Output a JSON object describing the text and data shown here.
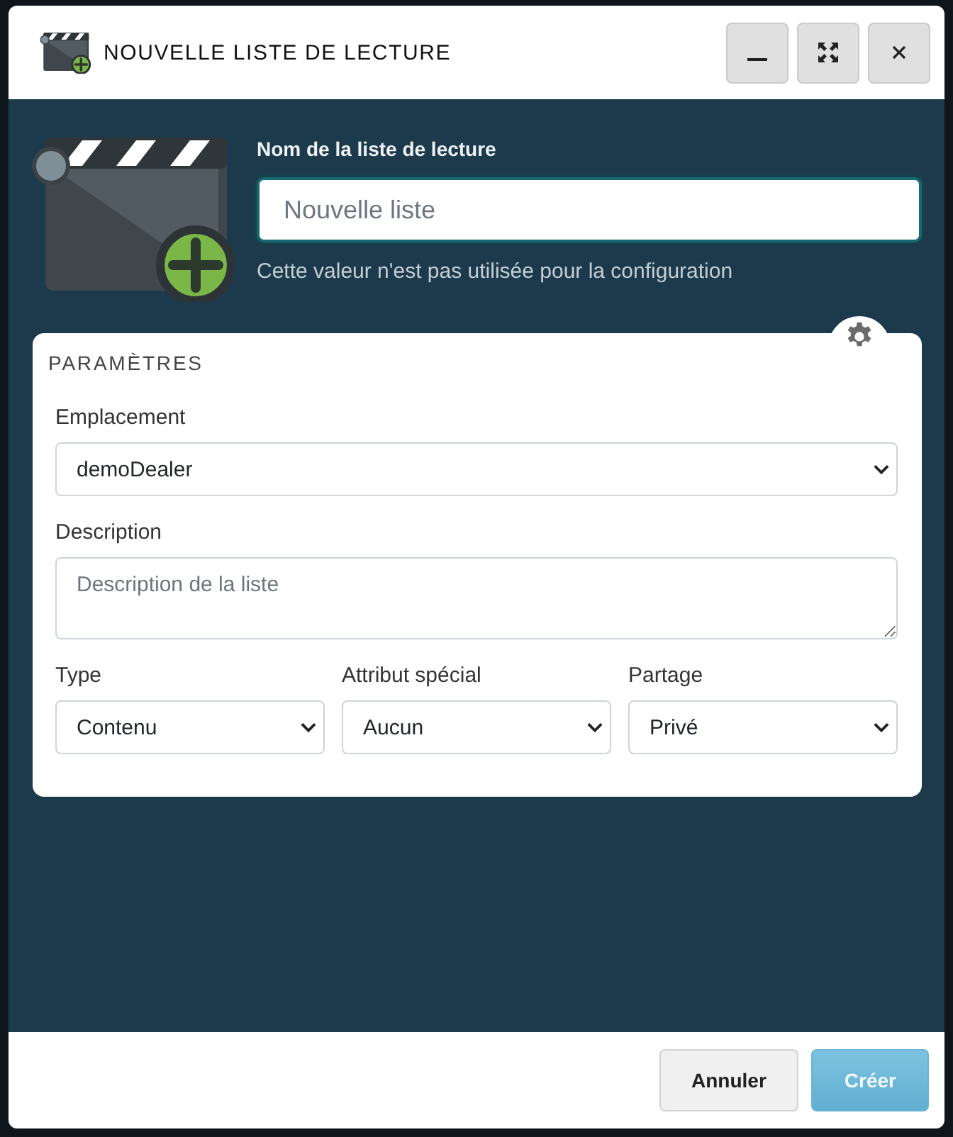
{
  "window": {
    "title": "NOUVELLE LISTE DE LECTURE"
  },
  "name_field": {
    "label": "Nom de la liste de lecture",
    "placeholder": "Nouvelle liste",
    "focused": true,
    "help": "Cette valeur n'est pas utilisée pour la configuration"
  },
  "settings": {
    "title": "PARAMÈTRES",
    "location": {
      "label": "Emplacement",
      "value": "demoDealer"
    },
    "description": {
      "label": "Description",
      "placeholder": "Description de la liste"
    },
    "selects": [
      {
        "label": "Type",
        "value": "Contenu"
      },
      {
        "label": "Attribut spécial",
        "value": "Aucun"
      },
      {
        "label": "Partage",
        "value": "Privé"
      }
    ]
  },
  "footer": {
    "buttons": [
      {
        "label": "Annuler",
        "kind": "secondary",
        "disabled": false
      },
      {
        "label": "Créer",
        "kind": "primary",
        "disabled": true
      }
    ]
  }
}
